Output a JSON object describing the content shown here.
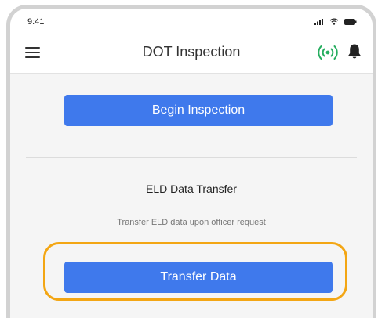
{
  "status_bar": {
    "time": "9:41"
  },
  "header": {
    "title": "DOT Inspection",
    "icons": [
      "menu-icon",
      "signal-broadcast-icon",
      "bell-icon"
    ],
    "signal_color": "#27ae60"
  },
  "inspection": {
    "begin_label": "Begin Inspection"
  },
  "eld": {
    "title": "ELD Data Transfer",
    "description": "Transfer ELD data upon officer request",
    "transfer_label": "Transfer Data"
  },
  "colors": {
    "primary_button": "#3f79ec",
    "highlight": "#f3a614"
  }
}
